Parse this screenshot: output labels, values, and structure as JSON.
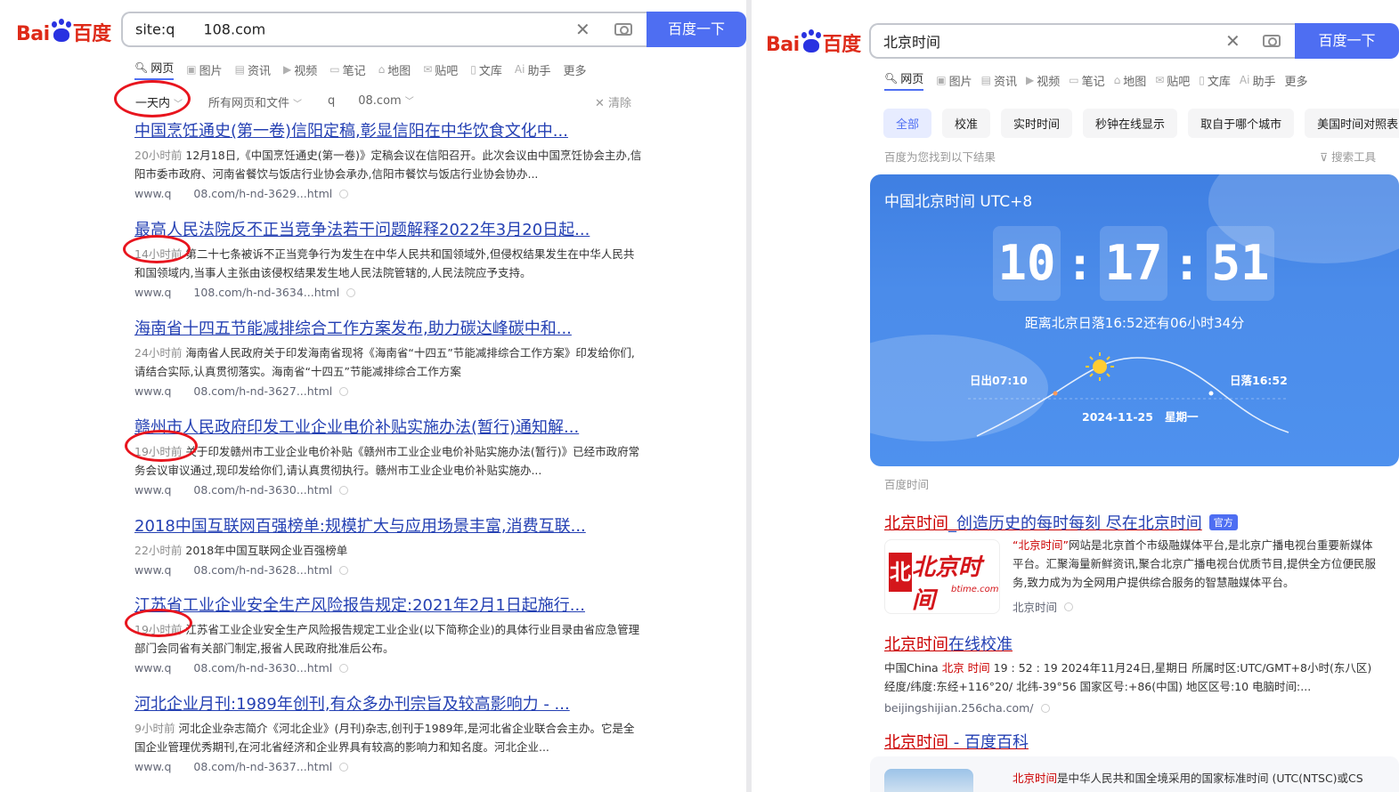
{
  "left": {
    "logo": {
      "bai": "Bai",
      "du": "du",
      "cn": "百度"
    },
    "search": {
      "query": "site:q  108.com",
      "button": "百度一下"
    },
    "tabs": [
      "网页",
      "图片",
      "资讯",
      "视频",
      "笔记",
      "地图",
      "贴吧",
      "文库",
      "助手",
      "更多"
    ],
    "filters": {
      "time": "一天内",
      "scope": "所有网页和文件",
      "site": "q  08.com",
      "clear": "清除"
    },
    "results": [
      {
        "title": "中国烹饪通史(第一卷)信阳定稿,彰显信阳在中华饮食文化中...",
        "time": "20小时前",
        "snippet": "12月18日,《中国烹饪通史(第一卷)》定稿会议在信阳召开。此次会议由中国烹饪协会主办,信阳市委市政府、河南省餐饮与饭店行业协会承办,信阳市餐饮与饭店行业协会协办...",
        "url": "www.q  08.com/h-nd-3629...html"
      },
      {
        "title": "最高人民法院反不正当竞争法若干问题解释2022年3月20日起...",
        "time": "14小时前",
        "snippet": "第二十七条被诉不正当竞争行为发生在中华人民共和国领域外,但侵权结果发生在中华人民共和国领域内,当事人主张由该侵权结果发生地人民法院管辖的,人民法院应予支持。",
        "url": "www.q  108.com/h-nd-3634...html"
      },
      {
        "title": "海南省十四五节能减排综合工作方案发布,助力碳达峰碳中和...",
        "time": "24小时前",
        "snippet": "海南省人民政府关于印发海南省现将《海南省“十四五”节能减排综合工作方案》印发给你们,请结合实际,认真贯彻落实。海南省“十四五”节能减排综合工作方案",
        "url": "www.q  08.com/h-nd-3627...html"
      },
      {
        "title": "赣州市人民政府印发工业企业电价补贴实施办法(暂行)通知解...",
        "time": "19小时前",
        "snippet": "关于印发赣州市工业企业电价补贴《赣州市工业企业电价补贴实施办法(暂行)》已经市政府常务会议审议通过,现印发给你们,请认真贯彻执行。赣州市工业企业电价补贴实施办...",
        "url": "www.q  08.com/h-nd-3630...html"
      },
      {
        "title": "2018中国互联网百强榜单:规模扩大与应用场景丰富,消费互联...",
        "time": "22小时前",
        "snippet": "2018年中国互联网企业百强榜单",
        "url": "www.q  08.com/h-nd-3628...html"
      },
      {
        "title": "江苏省工业企业安全生产风险报告规定:2021年2月1日起施行...",
        "time": "19小时前",
        "snippet": "江苏省工业企业安全生产风险报告规定工业企业(以下简称企业)的具体行业目录由省应急管理部门会同省有关部门制定,报省人民政府批准后公布。",
        "url": "www.q  08.com/h-nd-3630...html"
      },
      {
        "title": "河北企业月刊:1989年创刊,有众多办刊宗旨及较高影响力 - ...",
        "time": "9小时前",
        "snippet": "河北企业杂志简介《河北企业》(月刊)杂志,创刊于1989年,是河北省企业联合会主办。它是全国企业管理优秀期刊,在河北省经济和企业界具有较高的影响力和知名度。河北企业...",
        "url": "www.q  08.com/h-nd-3637...html"
      }
    ]
  },
  "right": {
    "logo": {
      "bai": "Bai",
      "du": "du",
      "cn": "百度"
    },
    "search": {
      "query": "北京时间",
      "button": "百度一下"
    },
    "tabs": [
      "网页",
      "图片",
      "资讯",
      "视频",
      "笔记",
      "地图",
      "贴吧",
      "文库",
      "助手",
      "更多"
    ],
    "chips": [
      "全部",
      "校准",
      "实时时间",
      "秒钟在线显示",
      "取自于哪个城市",
      "美国时间对照表"
    ],
    "found": "百度为您找到以下结果",
    "tools": "搜索工具",
    "clock": {
      "title": "中国北京时间 UTC+8",
      "hh": "10",
      "mm": "17",
      "ss": "51",
      "sunset_note": "距离北京日落16:52还有06小时34分",
      "sunrise": "日出07:10",
      "sunset": "日落16:52",
      "date": "2024-11-25",
      "weekday": "星期一",
      "source": "百度时间"
    },
    "results": [
      {
        "title_hl": "北京时间",
        "title_rest": "_创造历史的每时每刻 尽在北京时间",
        "badge": "官方",
        "snippet_hl": "“北京时间”",
        "snippet": "网站是北京首个市级融媒体平台,是北京广播电视台重要新媒体平台。汇聚海量新鲜资讯,聚合北京广播电视台优质节目,提供全方位便民服务,致力成为为全网用户提供综合服务的智慧融媒体平台。",
        "logo_text": "北京时间",
        "logo_sub": "btime.com",
        "source": "北京时间"
      },
      {
        "title_hl": "北京时间",
        "title_rest": "在线校准",
        "snippet_pre": "中国China ",
        "snippet_hl": "北京 时间",
        "snippet": " 19 : 52 : 19 2024年11月24日,星期日 所属时区:UTC/GMT+8小时(东八区) 经度/纬度:东经+116°20/ 北纬-39°56 国家区号:+86(中国) 地区区号:10 电脑时间:...",
        "url": "beijingshijian.256cha.com/"
      },
      {
        "title_hl": "北京时间",
        "title_rest": " - 百度百科",
        "snippet_hl": "北京时间",
        "snippet": "是中华人民共和国全境采用的国家标准时间 (UTC(NTSC)或CS"
      }
    ]
  },
  "colors": {
    "brand_blue": "#4e6ef2",
    "link_blue": "#2440b3",
    "brand_red": "#de2a18",
    "highlight_red": "#c00",
    "annotation_red": "#e8151e"
  },
  "icons": [
    "close-icon",
    "camera-icon",
    "chevron-down-icon",
    "filter-icon",
    "sun-icon"
  ]
}
